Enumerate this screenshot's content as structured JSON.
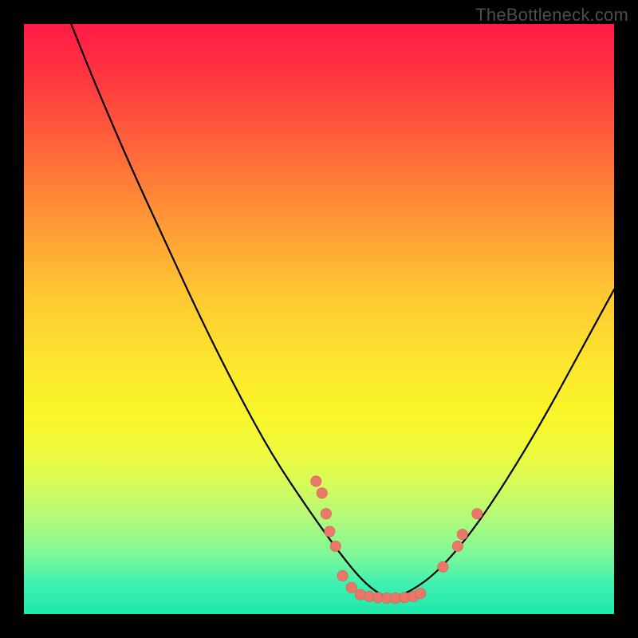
{
  "watermark": "TheBottleneck.com",
  "colors": {
    "curve": "#000000",
    "dot_fill": "#e9776a",
    "dot_stroke": "#d65a4e",
    "background_black": "#000000"
  },
  "chart_data": {
    "type": "line",
    "title": "",
    "xlabel": "",
    "ylabel": "",
    "xlim": [
      0,
      100
    ],
    "ylim": [
      0,
      100
    ],
    "note": "Coordinates expressed as percentages of the 740x740 plot area (0,0 = top-left after framing). Curve is a V-shape dipping to ~y=97 near x=62.",
    "series": [
      {
        "name": "bottleneck-curve",
        "x": [
          8,
          12,
          18,
          24,
          30,
          36,
          42,
          48,
          53,
          57,
          60,
          62,
          65,
          70,
          76,
          82,
          88,
          94,
          100
        ],
        "y": [
          0,
          10,
          24,
          37,
          50,
          62,
          73,
          82,
          89,
          94,
          96.5,
          97.2,
          96.5,
          93,
          86,
          77,
          67,
          56,
          45
        ]
      }
    ],
    "points": [
      {
        "x": 49.5,
        "y": 77.5
      },
      {
        "x": 50.5,
        "y": 79.5
      },
      {
        "x": 51.2,
        "y": 83.0
      },
      {
        "x": 51.8,
        "y": 86.0
      },
      {
        "x": 52.8,
        "y": 88.5
      },
      {
        "x": 54.0,
        "y": 93.5
      },
      {
        "x": 55.5,
        "y": 95.5
      },
      {
        "x": 57.0,
        "y": 96.7
      },
      {
        "x": 58.5,
        "y": 97.0
      },
      {
        "x": 60.0,
        "y": 97.2
      },
      {
        "x": 61.5,
        "y": 97.3
      },
      {
        "x": 63.0,
        "y": 97.3
      },
      {
        "x": 64.5,
        "y": 97.2
      },
      {
        "x": 66.0,
        "y": 97.0
      },
      {
        "x": 67.2,
        "y": 96.5
      },
      {
        "x": 71.0,
        "y": 92.0
      },
      {
        "x": 73.5,
        "y": 88.5
      },
      {
        "x": 74.3,
        "y": 86.5
      },
      {
        "x": 76.8,
        "y": 83.0
      }
    ],
    "dot_radius_pct": 0.9
  }
}
